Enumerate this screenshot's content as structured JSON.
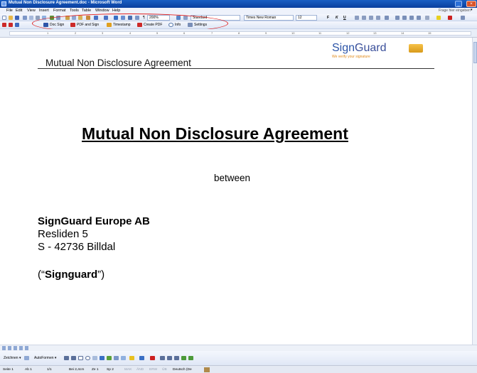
{
  "window": {
    "title": "Mutual Non Disclosure Agreement.doc - Microsoft Word",
    "minimize_label": "_",
    "close_label": "×"
  },
  "menu": {
    "items": [
      "File",
      "Edit",
      "View",
      "Insert",
      "Format",
      "Tools",
      "Table",
      "Window",
      "Help"
    ],
    "help_box": "Frage hier eingeben",
    "help_arrow": "▾"
  },
  "toolbar_standard": {
    "zoom": "200%",
    "style": "Standard",
    "font": "Times New Roman",
    "size": "12",
    "bold": "F",
    "italic": "K",
    "underline": "U"
  },
  "signguard_toolbar": {
    "buttons": [
      "Doc Sign",
      "PDF and Sign",
      "Timestamp",
      "Create PDF",
      "Info",
      "Settings"
    ]
  },
  "ruler": {
    "numbers": [
      "1",
      "2",
      "3",
      "4",
      "5",
      "6",
      "7",
      "8",
      "9",
      "10",
      "11",
      "12",
      "13",
      "14",
      "15"
    ]
  },
  "document": {
    "header_title": "Mutual Non Disclosure Agreement",
    "logo": {
      "name_sign": "Sign",
      "name_guard": "Guard",
      "tagline": "We verify your signature"
    },
    "title": "Mutual Non Disclosure Agreement",
    "between": "between",
    "party": {
      "name": "SignGuard Europe AB",
      "street": "Resliden 5",
      "city": "S - 42736 Billdal",
      "short_open": "(“",
      "short_name": "Signguard",
      "short_close": "”)"
    }
  },
  "drawing_toolbar": {
    "draw_label": "Zeichnen ▾",
    "autoshapes_label": "AutoFormen ▾"
  },
  "statusbar": {
    "page": "Seite 1",
    "section": "Ab 1",
    "pages": "1/1",
    "position": "Bei 2,4cm",
    "line": "Ze 1",
    "column": "Sp 2",
    "mak": "MAK",
    "aend": "ÄND",
    "erw": "ERW",
    "ub": "ÜB",
    "language": "Deutsch (De"
  },
  "colors": {
    "title_bar": "#0a3f9e",
    "oval": "#e02020",
    "logo_blue": "#2d55a8",
    "logo_orange": "#e08a1a"
  }
}
